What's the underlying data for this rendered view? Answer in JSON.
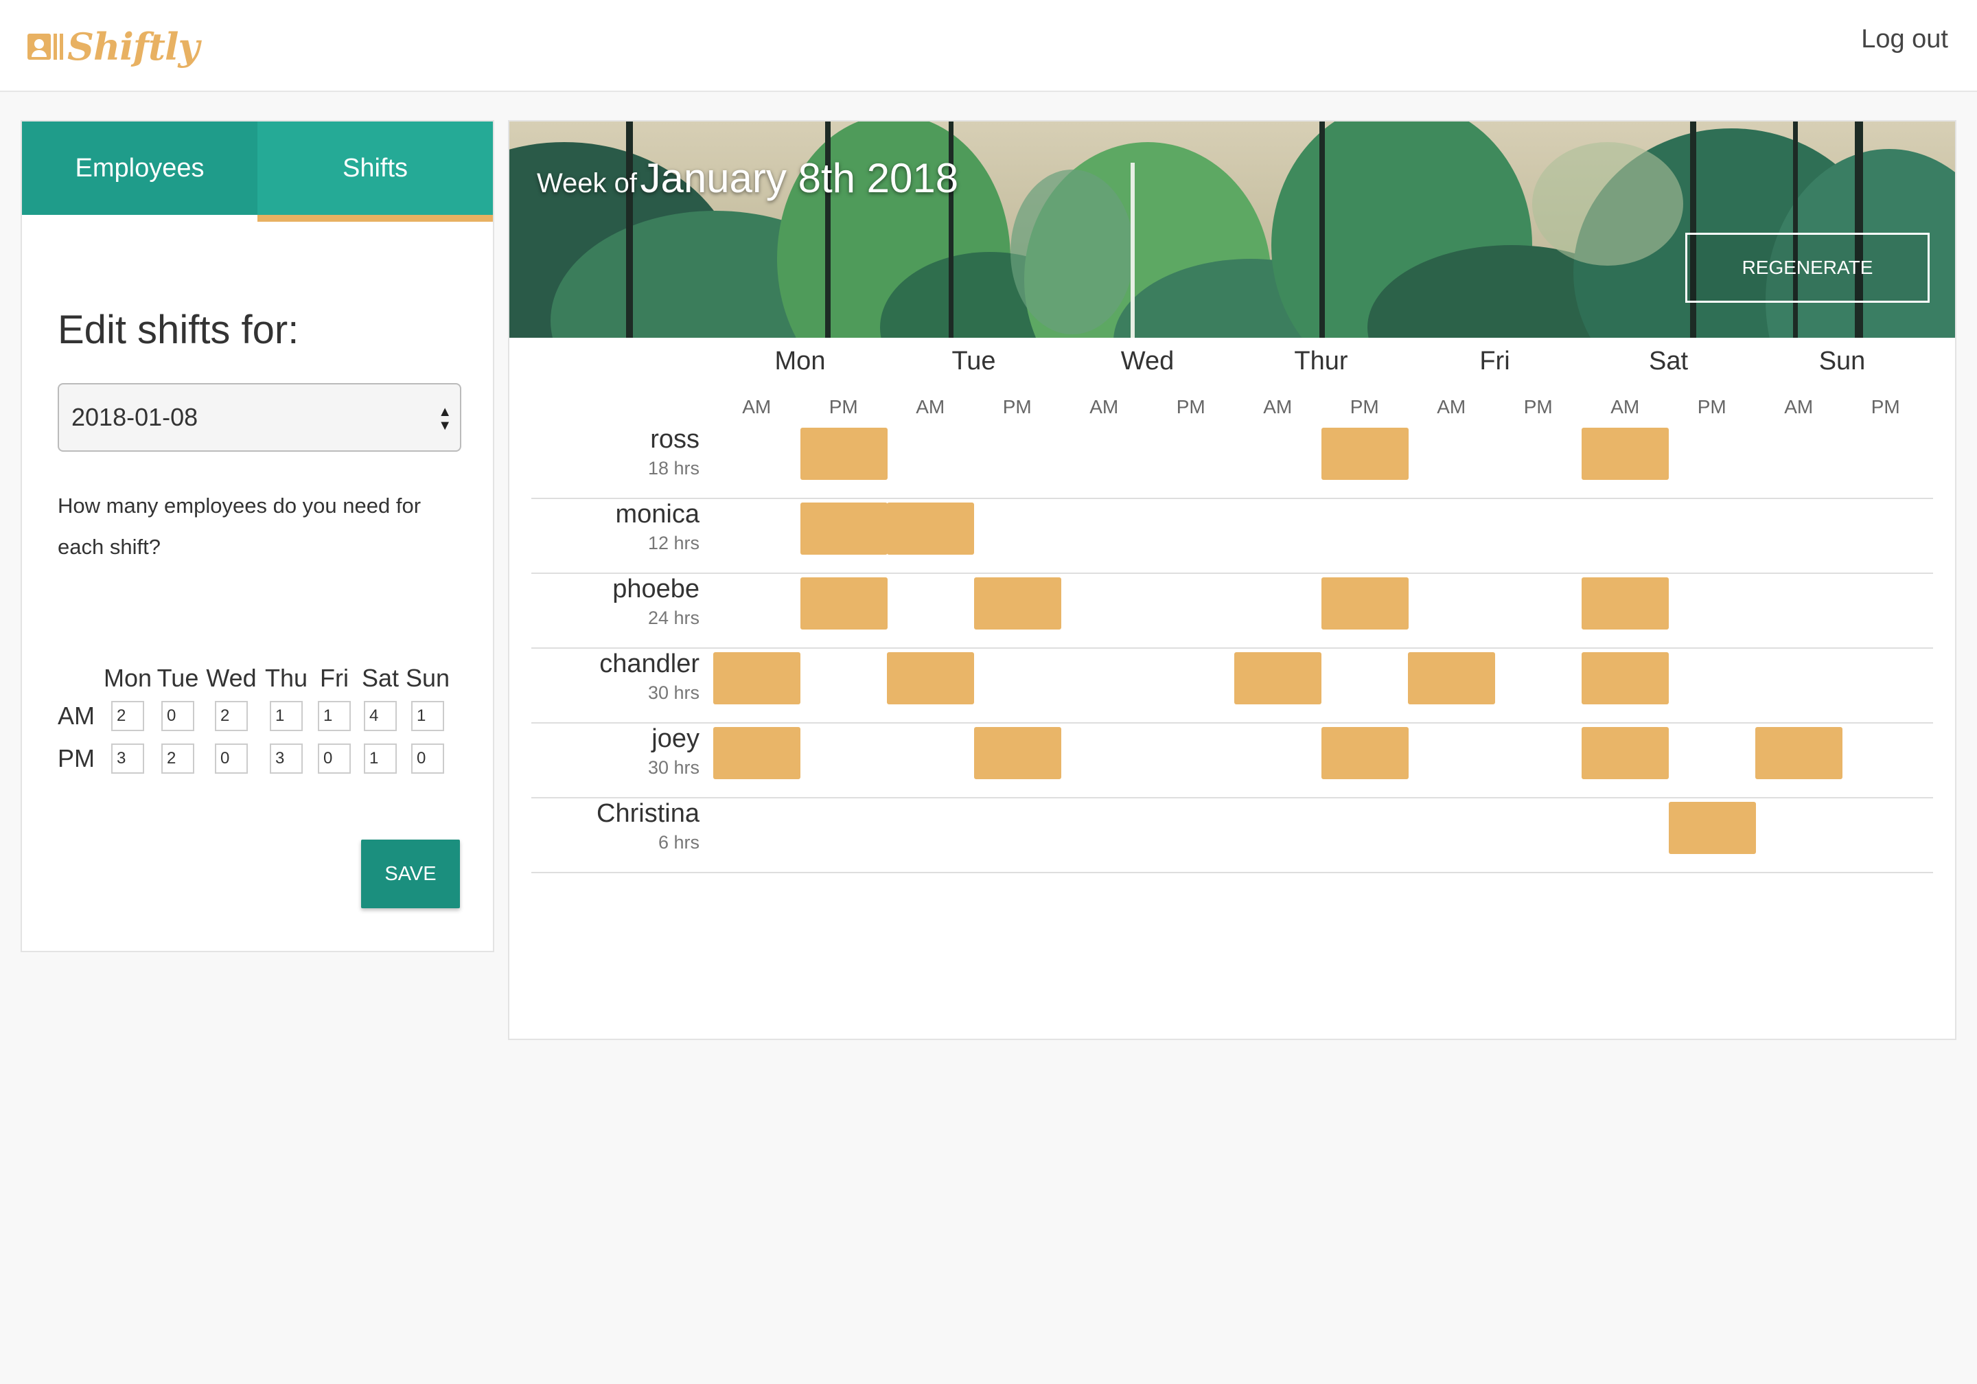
{
  "app": {
    "logo_text": "Shiftly",
    "logout_label": "Log out"
  },
  "tabs": [
    {
      "label": "Employees"
    },
    {
      "label": "Shifts"
    }
  ],
  "edit": {
    "title": "Edit shifts for:",
    "selected_date": "2018-01-08",
    "question": "How many employees do you need for each shift?",
    "days": [
      "Mon",
      "Tue",
      "Wed",
      "Thu",
      "Fri",
      "Sat",
      "Sun"
    ],
    "am_label": "AM",
    "pm_label": "PM",
    "am": [
      "2",
      "0",
      "2",
      "1",
      "1",
      "4",
      "1"
    ],
    "pm": [
      "3",
      "2",
      "0",
      "3",
      "0",
      "1",
      "0"
    ],
    "save_label": "SAVE"
  },
  "banner": {
    "prefix": "Week of",
    "date": "January 8th 2018",
    "regenerate_label": "REGENERATE"
  },
  "schedule": {
    "days": [
      "Mon",
      "Tue",
      "Wed",
      "Thur",
      "Fri",
      "Sat",
      "Sun"
    ],
    "am_label": "AM",
    "pm_label": "PM",
    "shift_color": "#e9b568",
    "employees": [
      {
        "name": "ross",
        "hours": "18 hrs",
        "shifts": [
          [
            0,
            "PM"
          ],
          [
            3,
            "PM"
          ],
          [
            5,
            "AM"
          ]
        ]
      },
      {
        "name": "monica",
        "hours": "12 hrs",
        "shifts": [
          [
            0,
            "PM"
          ],
          [
            1,
            "AM"
          ]
        ]
      },
      {
        "name": "phoebe",
        "hours": "24 hrs",
        "shifts": [
          [
            0,
            "PM"
          ],
          [
            1,
            "PM"
          ],
          [
            3,
            "PM"
          ],
          [
            5,
            "AM"
          ]
        ]
      },
      {
        "name": "chandler",
        "hours": "30 hrs",
        "shifts": [
          [
            0,
            "AM"
          ],
          [
            1,
            "AM"
          ],
          [
            3,
            "AM"
          ],
          [
            4,
            "AM"
          ],
          [
            5,
            "AM"
          ]
        ]
      },
      {
        "name": "joey",
        "hours": "30 hrs",
        "shifts": [
          [
            0,
            "AM"
          ],
          [
            1,
            "PM"
          ],
          [
            3,
            "PM"
          ],
          [
            5,
            "AM"
          ],
          [
            6,
            "AM"
          ]
        ]
      },
      {
        "name": "Christina",
        "hours": "6 hrs",
        "shifts": [
          [
            5,
            "PM"
          ]
        ]
      }
    ]
  },
  "colors": {
    "teal_dark": "#1f9c8a",
    "teal": "#25aa96",
    "accent": "#e8b162"
  }
}
